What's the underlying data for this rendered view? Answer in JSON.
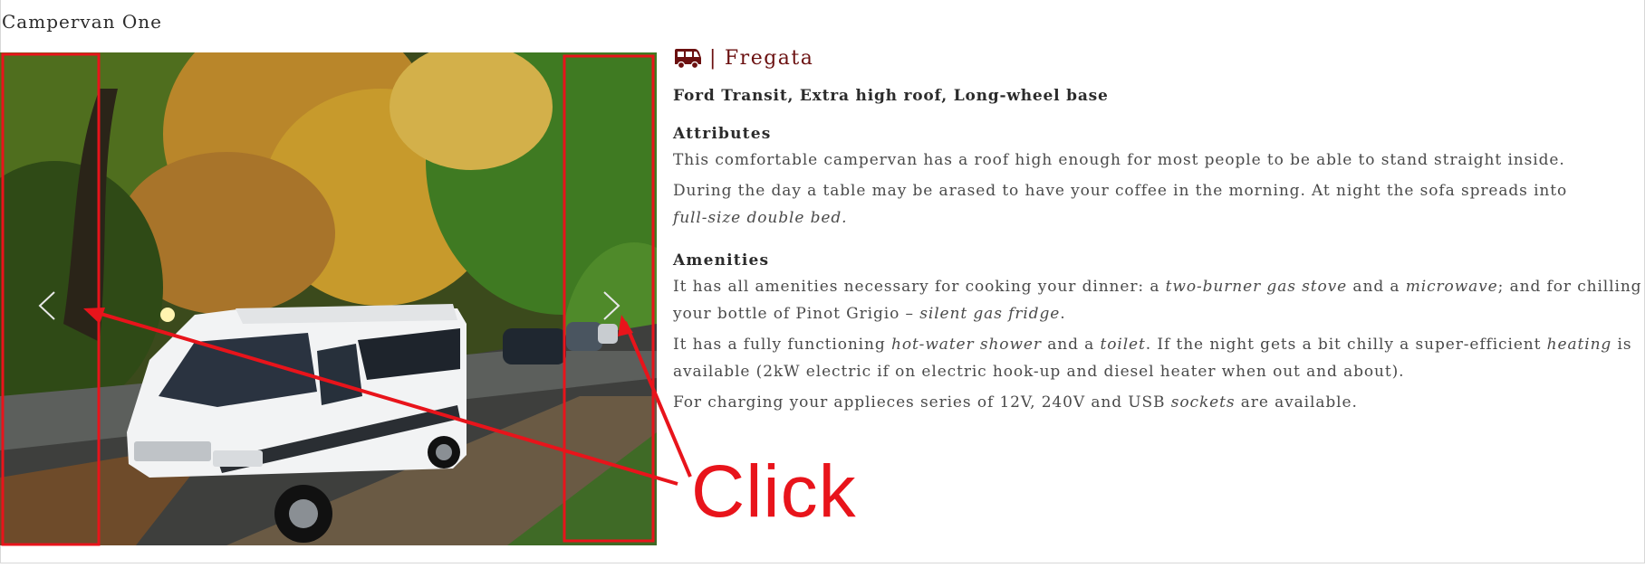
{
  "page": {
    "title": "Campervan One"
  },
  "gallery": {
    "prev_icon": "chevron-left-icon",
    "next_icon": "chevron-right-icon"
  },
  "info": {
    "brand_icon": "campervan-icon",
    "brand_separator": "|",
    "brand_name": "Fregata",
    "subtitle": "Ford Transit, Extra high roof, Long-wheel base",
    "attributes": {
      "heading": "Attributes",
      "p1": "This comfortable campervan has a roof high enough for most people to be able to stand straight inside.",
      "p2a": "During the day a table may be arased to have your coffee in the morning. At night the sofa spreads into",
      "p2b": "full-size double bed."
    },
    "amenities": {
      "heading": "Amenities",
      "p1a": "It has all amenities necessary for cooking your dinner: a ",
      "p1b": "two-burner gas stove",
      "p1c": " and a ",
      "p1d": "microwave",
      "p1e": "; and for chilling your bottle of Pinot Grigio – ",
      "p1f": "silent gas fridge",
      "p1g": ".",
      "p2a": "It has a fully functioning ",
      "p2b": "hot-water shower",
      "p2c": " and a ",
      "p2d": "toilet",
      "p2e": ". If the night gets a bit chilly a super-efficient ",
      "p2f": "heating",
      "p2g": " is available (2kW electric if on electric hook-up and diesel heater when out and about).",
      "p3a": "For charging your applieces series of 12V, 240V and USB ",
      "p3b": "sockets",
      "p3c": " are available."
    }
  },
  "annotation": {
    "label": "Click",
    "color": "#e8141b"
  }
}
